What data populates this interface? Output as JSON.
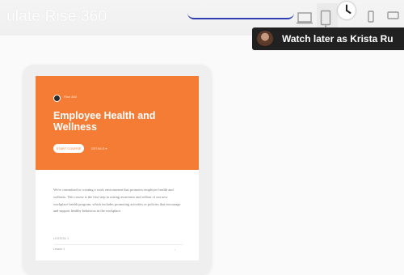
{
  "video": {
    "title": "ulate Rise 360"
  },
  "toolbar": {
    "device_icons": [
      "laptop-icon",
      "tablet-portrait-icon",
      "tablet-landscape-icon",
      "phone-portrait-icon",
      "phone-landscape-icon"
    ],
    "selected_device": "tablet-portrait-icon",
    "annotation_color": "#2f3fb3"
  },
  "watch_later": {
    "text": "Watch later as Krista Ru"
  },
  "course": {
    "author": "Rise 360",
    "title": "Employee Health and Wellness",
    "start_label": "START COURSE",
    "details_label": "DETAILS  ▾",
    "description": "We're committed to creating a work environment that promotes employee health and wellness. This course is the first step in raising awareness and rollout of our new workplace health program, which includes promoting activities or policies that encourage and support healthy behaviors in the workplace.",
    "lessons_label": "LESSON 1",
    "lesson_item": "Lesson 1",
    "accent_color": "#f47c35"
  }
}
